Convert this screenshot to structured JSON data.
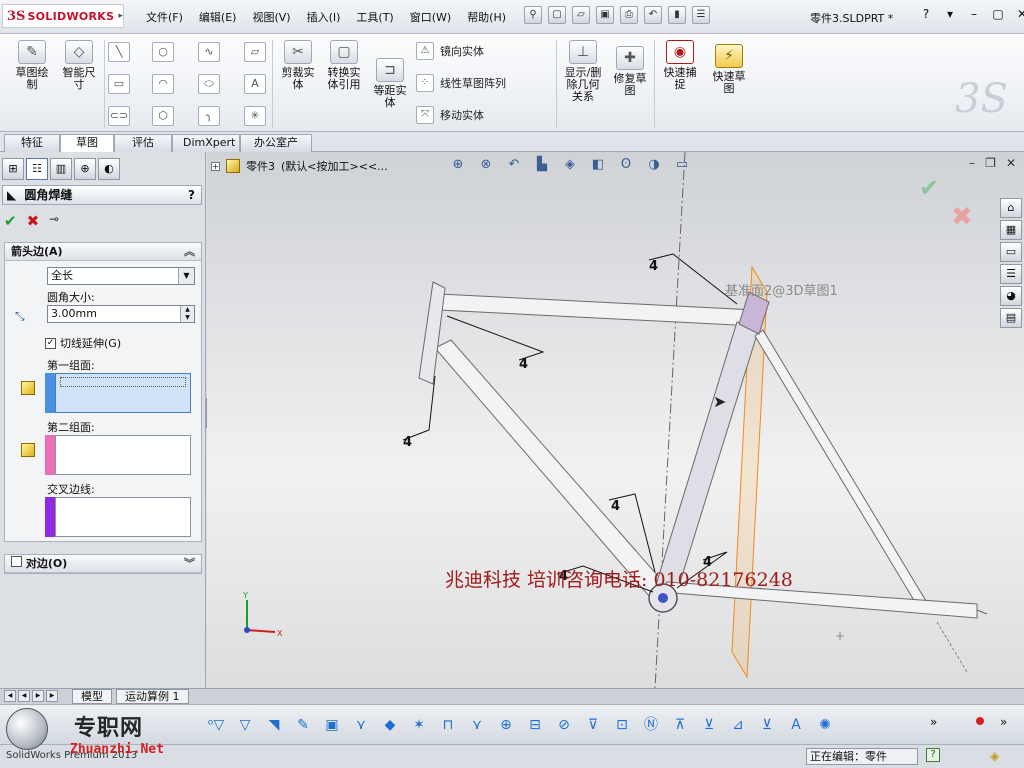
{
  "app": {
    "brand": "SOLIDWORKS",
    "doc_title": "零件3.SLDPRT *"
  },
  "menu": [
    "文件(F)",
    "编辑(E)",
    "视图(V)",
    "插入(I)",
    "工具(T)",
    "窗口(W)",
    "帮助(H)"
  ],
  "ribbon": {
    "sketch": "草图绘\n制",
    "smart_dim": "智能尺\n寸",
    "trim": "剪裁实\n体",
    "convert": "转换实\n体引用",
    "offset": "等距实\n体",
    "mirror": "镜向实体",
    "linear_pattern": "线性草图阵列",
    "move": "移动实体",
    "show_relations": "显示/删\n除几何\n关系",
    "repair": "修复草\n图",
    "quick_snap": "快速捕\n捉",
    "rapid_sketch": "快速草\n图"
  },
  "tabs": [
    "特征",
    "草图",
    "评估",
    "DimXpert",
    "办公室产品"
  ],
  "active_tab": "草图",
  "pm": {
    "title": "圆角焊缝",
    "help": "?",
    "arrow_side": "箭头边(A)",
    "length_type": "全长",
    "fillet_size_label": "圆角大小:",
    "fillet_size": "3.00mm",
    "tangent": "切线延伸(G)",
    "face_set1": "第一组面:",
    "face_set2": "第二组面:",
    "intersect_edge": "交叉边线:",
    "other_side": "对边(O)",
    "colors": {
      "set1": "#4a90e2",
      "set2": "#ea6fb6",
      "edge": "#8e2be2"
    }
  },
  "graphics": {
    "tree_item": "零件3",
    "config": "(默认<按加工><<...",
    "sketch_label": "基准面2@3D草图1",
    "weld_symbol": "4",
    "promo": "兆迪科技    培训咨询电话: 010-82176248"
  },
  "model_tabs": [
    "模型",
    "运动算例 1"
  ],
  "status": {
    "app": "SolidWorks Premium 2013",
    "editing": "正在编辑：零件",
    "help": "?"
  },
  "watermark": {
    "cn": "专职网",
    "en": "Zhuanzhi.Net"
  }
}
